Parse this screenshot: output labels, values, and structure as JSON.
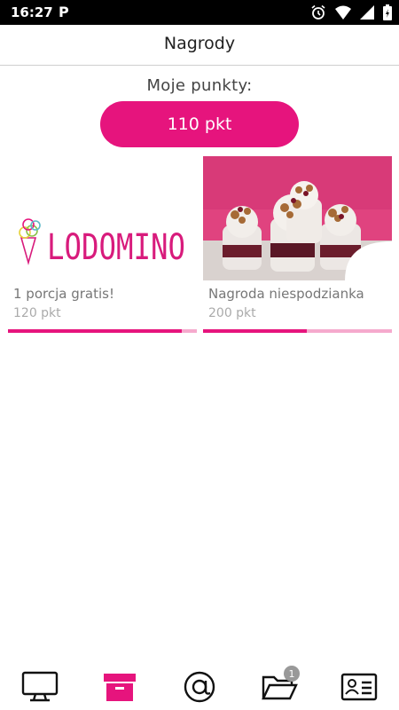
{
  "status_bar": {
    "time": "16:27",
    "app_icon": "P",
    "battery_icon": "battery-charging-icon"
  },
  "header": {
    "title": "Nagrody"
  },
  "points": {
    "label": "Moje punkty:",
    "value": "110 pkt"
  },
  "rewards": [
    {
      "brand": "LODOMINO",
      "title": "1 porcja gratis!",
      "cost": "120 pkt",
      "progress": 0.92
    },
    {
      "title": "Nagroda niespodzianka",
      "cost": "200 pkt",
      "progress": 0.55
    }
  ],
  "bottom_nav": {
    "items": [
      {
        "icon": "monitor-icon",
        "active": false
      },
      {
        "icon": "archive-box-icon",
        "active": true
      },
      {
        "icon": "at-sign-icon",
        "active": false
      },
      {
        "icon": "folder-open-icon",
        "active": false,
        "badge": "1"
      },
      {
        "icon": "id-card-icon",
        "active": false
      }
    ]
  },
  "colors": {
    "accent": "#e6147d",
    "accent_light": "#f5aacd",
    "text_muted": "#aaaaaa"
  }
}
